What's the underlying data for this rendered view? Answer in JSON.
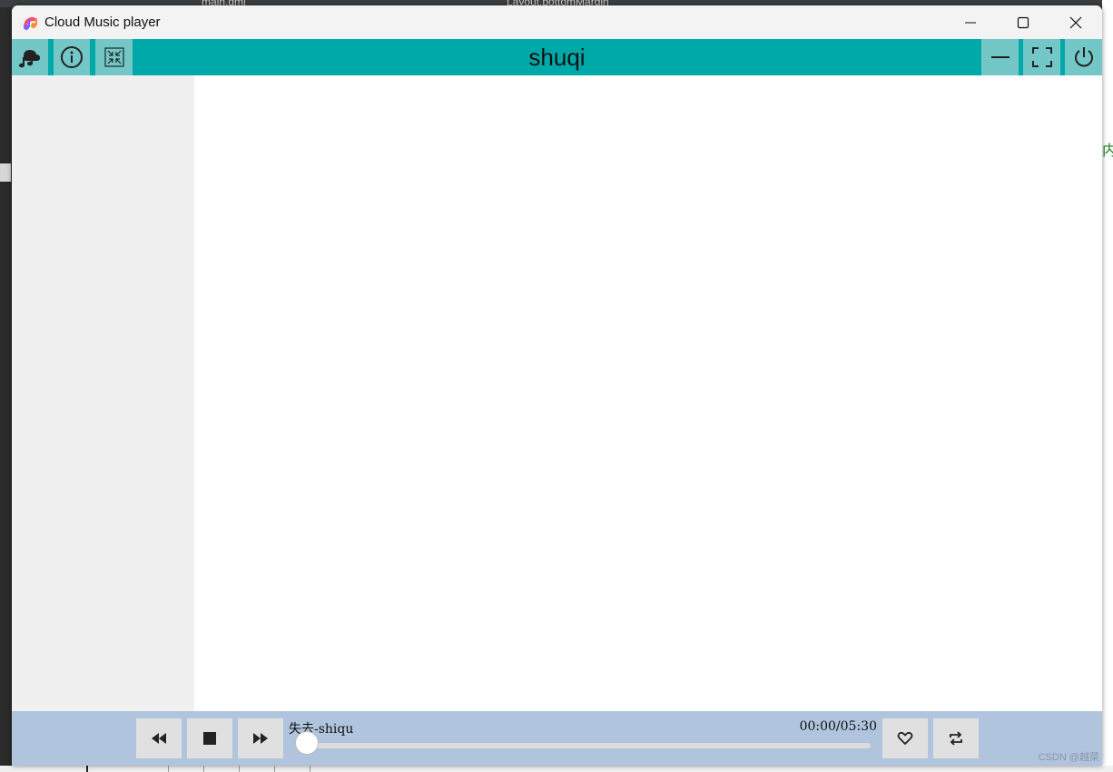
{
  "window": {
    "title": "Cloud Music player"
  },
  "background": {
    "tabs": [
      "main.qml",
      "Layout.bottomMargin"
    ],
    "right_char": "内"
  },
  "toolbar": {
    "title": "shuqi",
    "left_icons": [
      "music-cloud-icon",
      "info-icon",
      "collapse-icon"
    ],
    "right_icons": [
      "minimize-line-icon",
      "fullscreen-icon",
      "power-icon"
    ],
    "teal": "#00a9a9",
    "button_bg": "#73c7c7"
  },
  "player": {
    "song": "失去-shiqu",
    "time": "00:00/05:30",
    "progress": 0.0,
    "buttons": [
      "previous-icon",
      "stop-icon",
      "next-icon",
      "heart-icon",
      "repeat-icon"
    ],
    "bar_color": "#b0c4de"
  },
  "watermark": "CSDN @越菜"
}
